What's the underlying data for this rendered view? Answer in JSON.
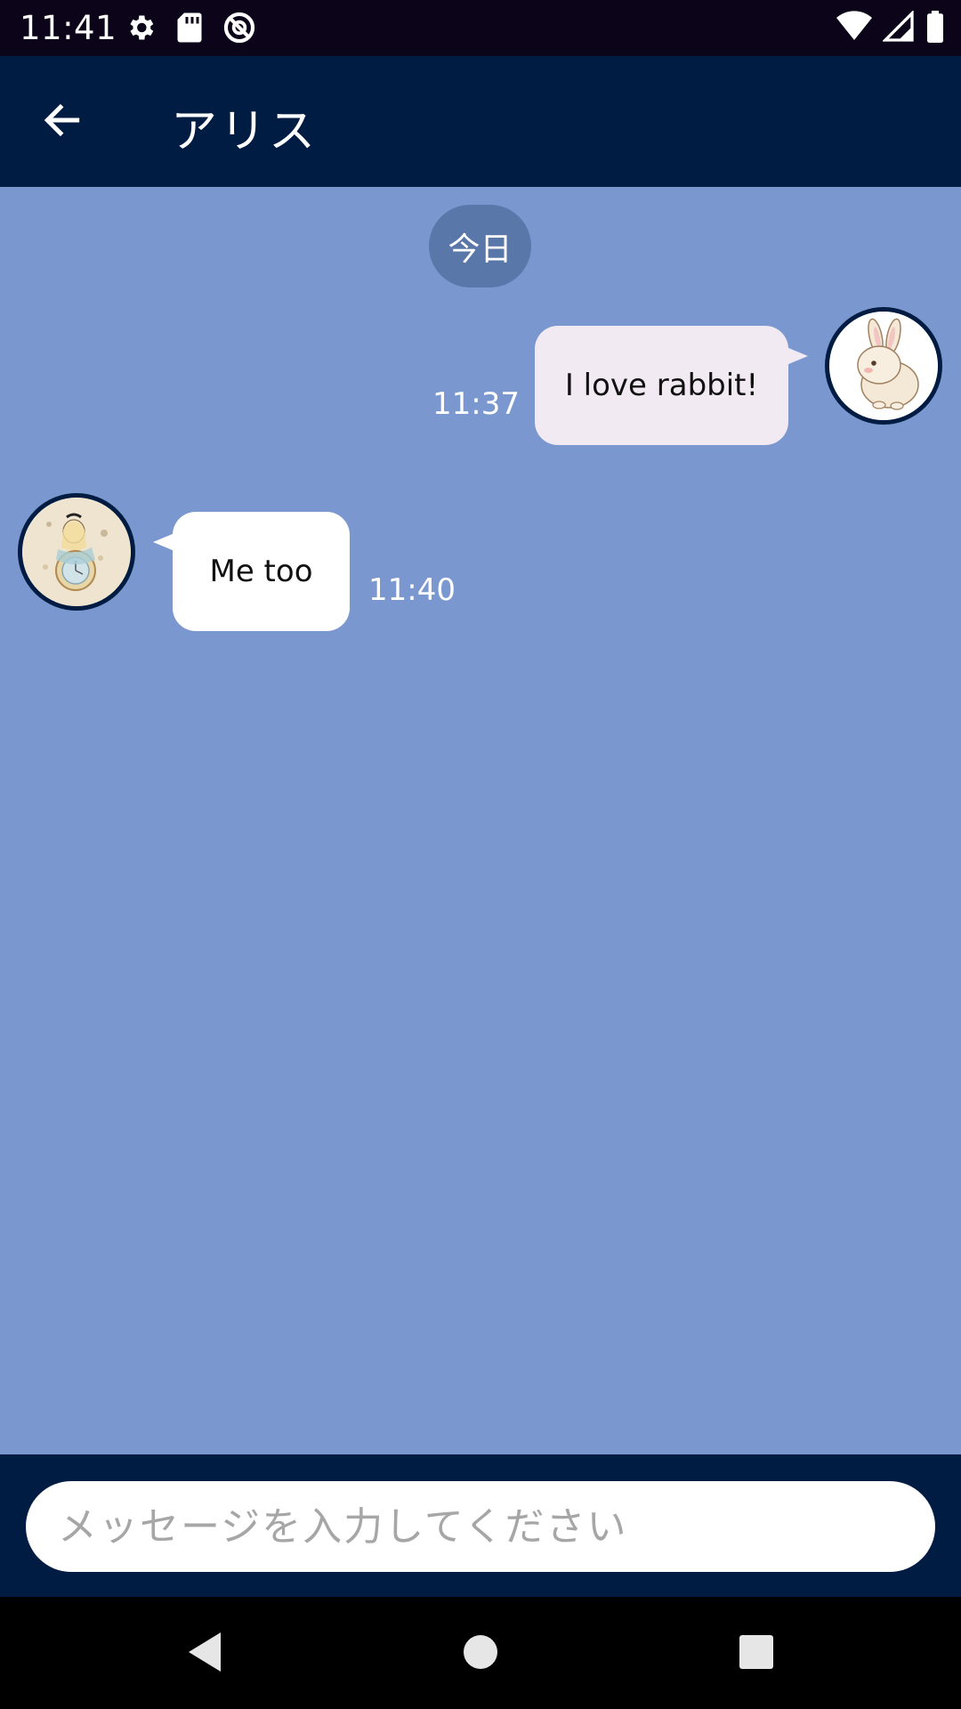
{
  "status_bar": {
    "time": "11:41",
    "icons_left": [
      "settings-gear-icon",
      "sd-card-icon",
      "no-disturb-icon"
    ],
    "icons_right": [
      "wifi-icon",
      "cell-signal-icon",
      "battery-icon"
    ]
  },
  "app_bar": {
    "back_icon": "arrow-left-icon",
    "title": "アリス"
  },
  "chat": {
    "date_chip": "今日",
    "messages": [
      {
        "direction": "outgoing",
        "text": "I love rabbit!",
        "time": "11:37",
        "avatar": "rabbit"
      },
      {
        "direction": "incoming",
        "text": "Me too",
        "time": "11:40",
        "avatar": "alice"
      }
    ]
  },
  "input": {
    "value": "",
    "placeholder": "メッセージを入力してください"
  },
  "nav_bar": {
    "icons": [
      "nav-back-triangle-icon",
      "nav-home-circle-icon",
      "nav-recents-square-icon"
    ]
  },
  "colors": {
    "app_bar": "#011c43",
    "chat_background": "#7a98cf",
    "date_chip": "#5a77a9",
    "outgoing_bubble": "#f2eaf2",
    "incoming_bubble": "#ffffff"
  }
}
